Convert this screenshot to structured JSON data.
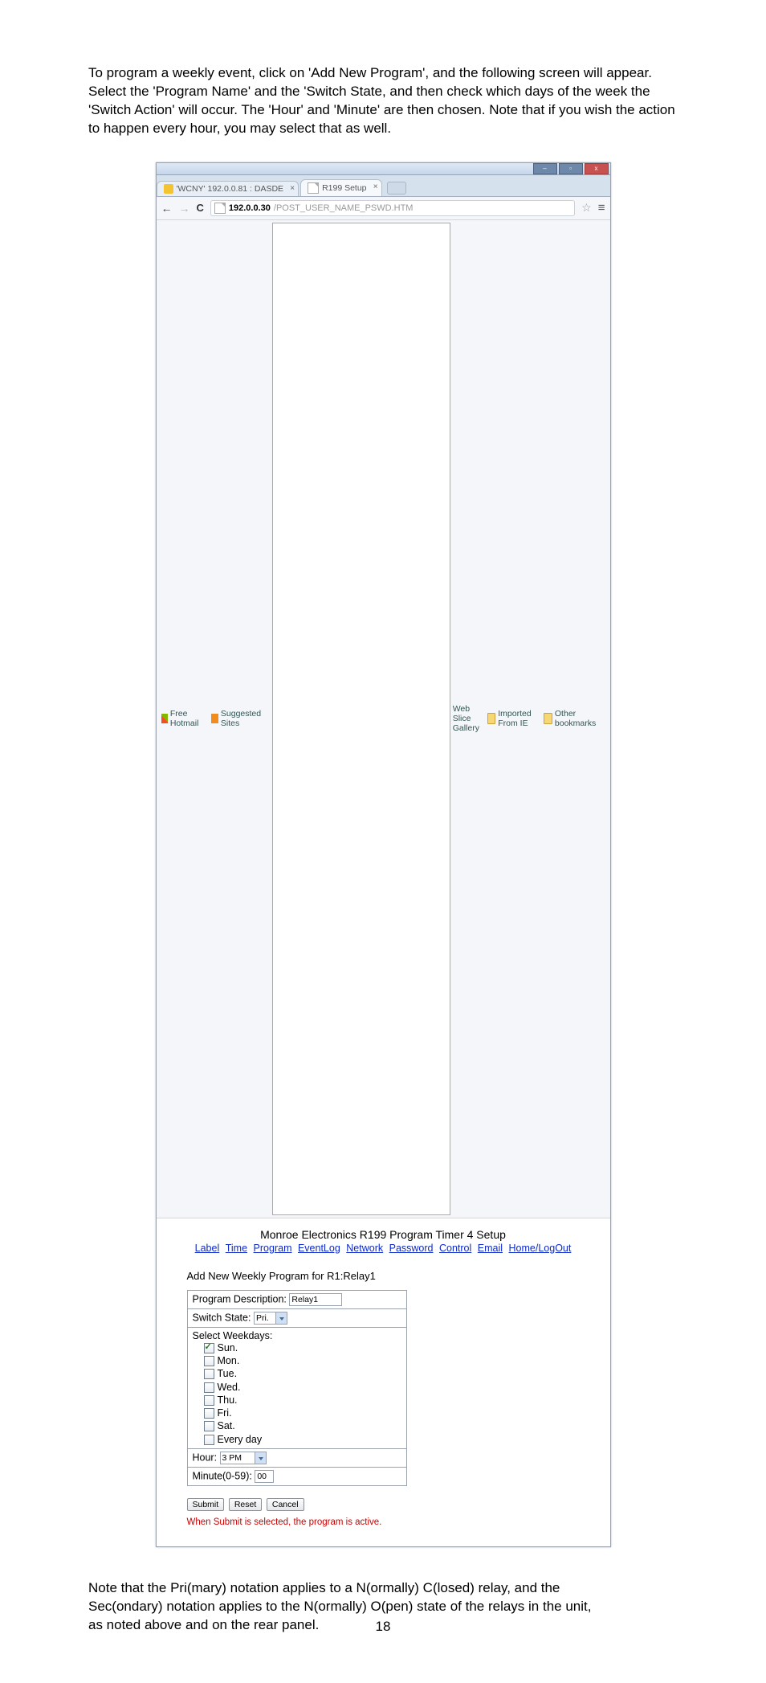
{
  "doc": {
    "para1": "To program a weekly event, click on 'Add New Program', and the following screen will appear. Select the 'Program Name' and the 'Switch State, and then check which days of the week the 'Switch Action' will occur.  The 'Hour' and 'Minute' are then chosen.  Note that if you wish the action to happen every hour, you may select that as well.",
    "para2": "Note that the Pri(mary) notation applies to a N(ormally) C(losed) relay, and the Sec(ondary) notation applies to the N(ormally) O(pen) state of the relays in the unit, as noted above and on the rear panel.",
    "page_number": "18"
  },
  "tabs": {
    "t1": "'WCNY' 192.0.0.81 : DASDE",
    "t2": "R199 Setup"
  },
  "address": {
    "host": "192.0.0.30",
    "path": "/POST_USER_NAME_PSWD.HTM"
  },
  "bookmarks": {
    "b1": "Free Hotmail",
    "b2": "Suggested Sites",
    "b3": "Web Slice Gallery",
    "b4": "Imported From IE",
    "right": "Other bookmarks"
  },
  "page": {
    "title": "Monroe Electronics R199 Program Timer 4 Setup",
    "nav": {
      "label": "Label",
      "time": "Time",
      "program": "Program",
      "eventlog": "EventLog",
      "network": "Network",
      "password": "Password",
      "control": "Control",
      "email": "Email",
      "homelogout": "Home/LogOut"
    },
    "subtitle": "Add New Weekly Program for R1:Relay1",
    "fields": {
      "program_desc_label": "Program Description: ",
      "program_desc_value": "Relay1",
      "switch_state_label": "Switch State: ",
      "switch_state_value": "Pri.",
      "select_weekdays": "Select Weekdays:",
      "days": {
        "sun": "Sun.",
        "mon": "Mon.",
        "tue": "Tue.",
        "wed": "Wed.",
        "thu": "Thu.",
        "fri": "Fri.",
        "sat": "Sat.",
        "every": "Every day"
      },
      "hour_label": "Hour: ",
      "hour_value": "3 PM",
      "minute_label": "Minute(0-59): ",
      "minute_value": "00"
    },
    "buttons": {
      "submit": "Submit",
      "reset": "Reset",
      "cancel": "Cancel"
    },
    "rednote": "When Submit is selected, the program is active."
  }
}
